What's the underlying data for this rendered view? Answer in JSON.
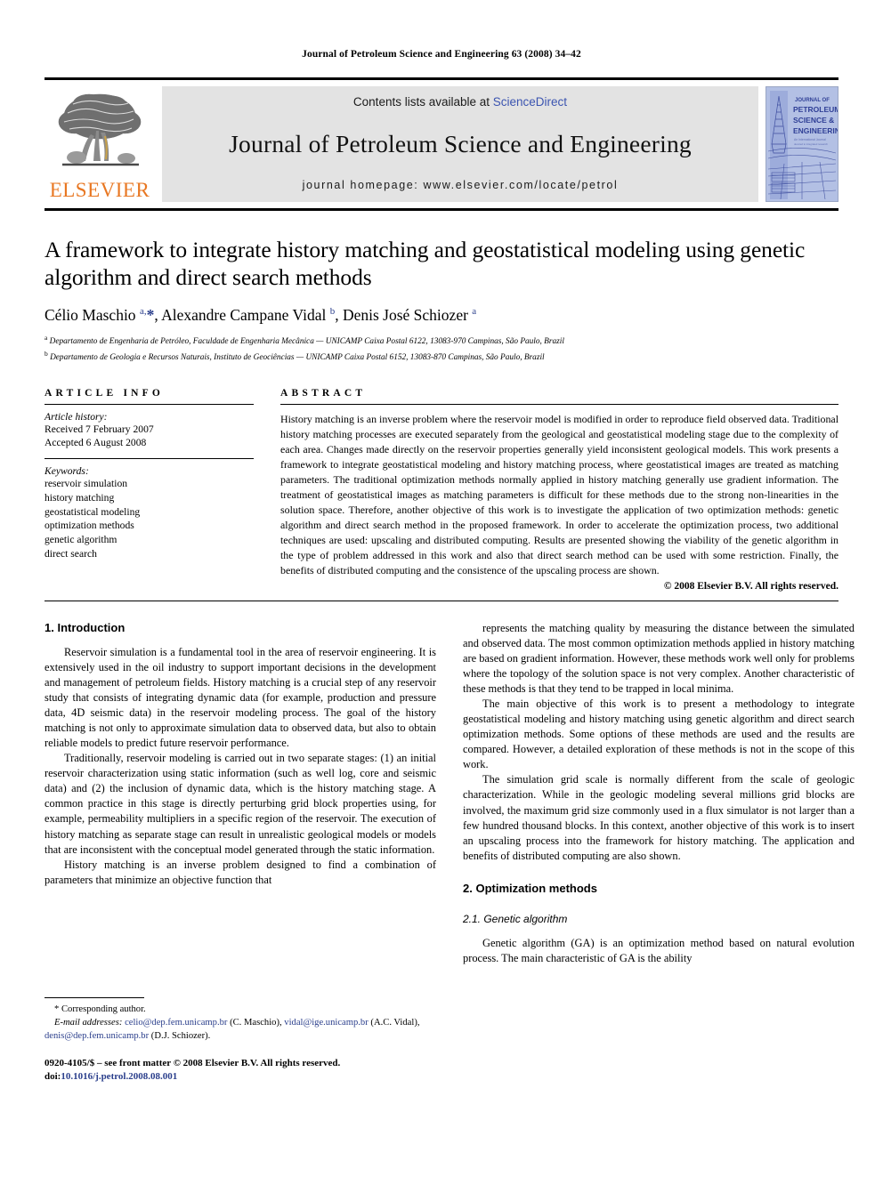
{
  "running_head": "Journal of Petroleum Science and Engineering 63 (2008) 34–42",
  "masthead": {
    "contents_prefix": "Contents lists available at",
    "sciencedirect": "ScienceDirect",
    "journal_title": "Journal of Petroleum Science and Engineering",
    "homepage_label": "journal homepage: www.elsevier.com/locate/petrol",
    "publisher_wordmark": "ELSEVIER",
    "cover": {
      "line1": "JOURNAL OF",
      "line2": "PETROLEUM",
      "line3": "SCIENCE &",
      "line4": "ENGINEERING",
      "subtitle": "An International Journal"
    },
    "link_color": "#3b54b0",
    "wordmark_color": "#E87722"
  },
  "article": {
    "title": "A framework to integrate history matching and geostatistical modeling using genetic algorithm and direct search methods",
    "authors_html": "Célio Maschio <sup>a,</sup><span class=\"star\">*</span>, Alexandre Campane Vidal <sup>b</sup>, Denis José Schiozer <sup>a</sup>",
    "affiliations": [
      "Departamento de Engenharia de Petróleo, Faculdade de Engenharia Mecânica — UNICAMP Caixa Postal 6122, 13083-970 Campinas, São Paulo, Brazil",
      "Departamento de Geologia e Recursos Naturais, Instituto de Geociências — UNICAMP Caixa Postal 6152, 13083-870 Campinas, São Paulo, Brazil"
    ],
    "affil_marks": [
      "a",
      "b"
    ]
  },
  "article_info": {
    "heading": "ARTICLE INFO",
    "history_label": "Article history:",
    "received": "Received 7 February 2007",
    "accepted": "Accepted 6 August 2008",
    "keywords_label": "Keywords:",
    "keywords": [
      "reservoir simulation",
      "history matching",
      "geostatistical modeling",
      "optimization methods",
      "genetic algorithm",
      "direct search"
    ]
  },
  "abstract": {
    "heading": "ABSTRACT",
    "text": "History matching is an inverse problem where the reservoir model is modified in order to reproduce field observed data. Traditional history matching processes are executed separately from the geological and geostatistical modeling stage due to the complexity of each area. Changes made directly on the reservoir properties generally yield inconsistent geological models. This work presents a framework to integrate geostatistical modeling and history matching process, where geostatistical images are treated as matching parameters. The traditional optimization methods normally applied in history matching generally use gradient information. The treatment of geostatistical images as matching parameters is difficult for these methods due to the strong non-linearities in the solution space. Therefore, another objective of this work is to investigate the application of two optimization methods: genetic algorithm and direct search method in the proposed framework. In order to accelerate the optimization process, two additional techniques are used: upscaling and distributed computing. Results are presented showing the viability of the genetic algorithm in the type of problem addressed in this work and also that direct search method can be used with some restriction. Finally, the benefits of distributed computing and the consistence of the upscaling process are shown.",
    "copyright": "© 2008 Elsevier B.V. All rights reserved."
  },
  "body": {
    "left": {
      "section_heading": "1. Introduction",
      "paragraphs": [
        "Reservoir simulation is a fundamental tool in the area of reservoir engineering. It is extensively used in the oil industry to support important decisions in the development and management of petroleum fields. History matching is a crucial step of any reservoir study that consists of integrating dynamic data (for example, production and pressure data, 4D seismic data) in the reservoir modeling process. The goal of the history matching is not only to approximate simulation data to observed data, but also to obtain reliable models to predict future reservoir performance.",
        "Traditionally, reservoir modeling is carried out in two separate stages: (1) an initial reservoir characterization using static information (such as well log, core and seismic data) and (2) the inclusion of dynamic data, which is the history matching stage. A common practice in this stage is directly perturbing grid block properties using, for example, permeability multipliers in a specific region of the reservoir. The execution of history matching as separate stage can result in unrealistic geological models or models that are inconsistent with the conceptual model generated through the static information.",
        "History matching is an inverse problem designed to find a combination of parameters that minimize an objective function that"
      ]
    },
    "right": {
      "paragraphs": [
        "represents the matching quality by measuring the distance between the simulated and observed data. The most common optimization methods applied in history matching are based on gradient information. However, these methods work well only for problems where the topology of the solution space is not very complex. Another characteristic of these methods is that they tend to be trapped in local minima.",
        "The main objective of this work is to present a methodology to integrate geostatistical modeling and history matching using genetic algorithm and direct search optimization methods. Some options of these methods are used and the results are compared. However, a detailed exploration of these methods is not in the scope of this work.",
        "The simulation grid scale is normally different from the scale of geologic characterization. While in the geologic modeling several millions grid blocks are involved, the maximum grid size commonly used in a flux simulator is not larger than a few hundred thousand blocks. In this context, another objective of this work is to insert an upscaling process into the framework for history matching. The application and benefits of distributed computing are also shown."
      ],
      "section_heading": "2. Optimization methods",
      "subsection_heading": "2.1. Genetic algorithm",
      "last_paragraph": "Genetic algorithm (GA) is an optimization method based on natural evolution process. The main characteristic of GA is the ability"
    }
  },
  "footnotes": {
    "corresponding_marker": "*",
    "corresponding_text": "Corresponding author.",
    "email_label": "E-mail addresses:",
    "emails": [
      {
        "address": "celio@dep.fem.unicamp.br",
        "owner": "(C. Maschio)"
      },
      {
        "address": "vidal@ige.unicamp.br",
        "owner": "(A.C. Vidal)"
      },
      {
        "address": "denis@dep.fem.unicamp.br",
        "owner": "(D.J. Schiozer)"
      }
    ],
    "issn_line": "0920-4105/$ – see front matter © 2008 Elsevier B.V. All rights reserved.",
    "doi_label": "doi:",
    "doi_value": "10.1016/j.petrol.2008.08.001"
  }
}
